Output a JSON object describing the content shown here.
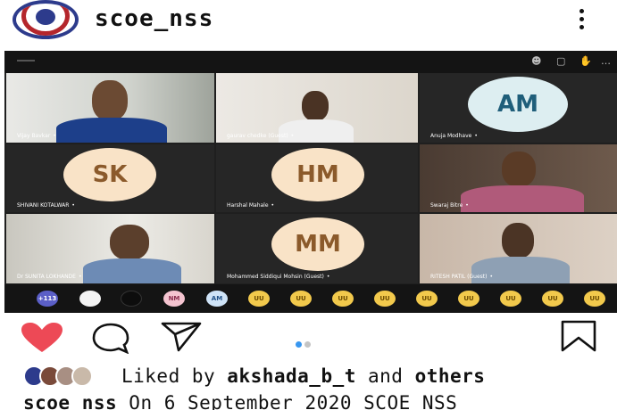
{
  "header": {
    "username": "scoe_nss",
    "logo_icon": "nss-emblem-icon",
    "more_icon": "vertical-ellipsis-icon"
  },
  "meeting": {
    "topbar_icons": [
      "participants-icon",
      "chat-icon",
      "hand-icon",
      "more-icon"
    ],
    "tiles": [
      {
        "name": "Vijay Bavkar",
        "type": "video"
      },
      {
        "name": "gaurav chedke (Guest)",
        "type": "video"
      },
      {
        "name": "Anuja Modhave",
        "type": "avatar",
        "initials": "AM"
      },
      {
        "name": "SHIVANI KOTALWAR",
        "type": "avatar",
        "initials": "SK"
      },
      {
        "name": "Harshal Mahale",
        "type": "avatar",
        "initials": "HM"
      },
      {
        "name": "Swaraj Bitre",
        "type": "video"
      },
      {
        "name": "Dr SUNITA LOKHANDE",
        "type": "video"
      },
      {
        "name": "Mohammed Siddiqui Mohsin (Guest)",
        "type": "avatar",
        "initials": "MM"
      },
      {
        "name": "RITESH PATIL (Guest)",
        "type": "video"
      }
    ],
    "strip": [
      {
        "label": "+113",
        "kind": "count"
      },
      {
        "label": "",
        "kind": "photo"
      },
      {
        "label": "",
        "kind": "dark"
      },
      {
        "label": "NM",
        "kind": "initials"
      },
      {
        "label": "AM",
        "kind": "initials"
      },
      {
        "label": "UU",
        "kind": "initials"
      },
      {
        "label": "UU",
        "kind": "initials"
      },
      {
        "label": "UU",
        "kind": "initials"
      },
      {
        "label": "UU",
        "kind": "initials"
      },
      {
        "label": "UU",
        "kind": "initials"
      },
      {
        "label": "UU",
        "kind": "initials"
      },
      {
        "label": "UU",
        "kind": "initials"
      },
      {
        "label": "UU",
        "kind": "initials"
      },
      {
        "label": "UU",
        "kind": "initials"
      },
      {
        "label": "UU",
        "kind": "initials"
      }
    ]
  },
  "actions": {
    "like_icon": "heart-icon",
    "comment_icon": "comment-icon",
    "share_icon": "send-icon",
    "save_icon": "bookmark-icon",
    "carousel_pages": 2,
    "carousel_active": 1
  },
  "likes": {
    "prefix": "Liked by ",
    "user": "akshada_b_t",
    "middle": " and ",
    "others": "others"
  },
  "caption": {
    "user": "scoe_nss",
    "text": " On 6 September 2020 SCOE NSS"
  },
  "colors": {
    "heart": "#ed4956",
    "avatar_bg": "#f9e3c7",
    "avatar_text": "#8b5a2b",
    "chip_bg": "#f2c94c",
    "chip_text": "#6b4b00",
    "dot_active": "#3897f0",
    "dot_inactive": "#c4c4c4"
  }
}
